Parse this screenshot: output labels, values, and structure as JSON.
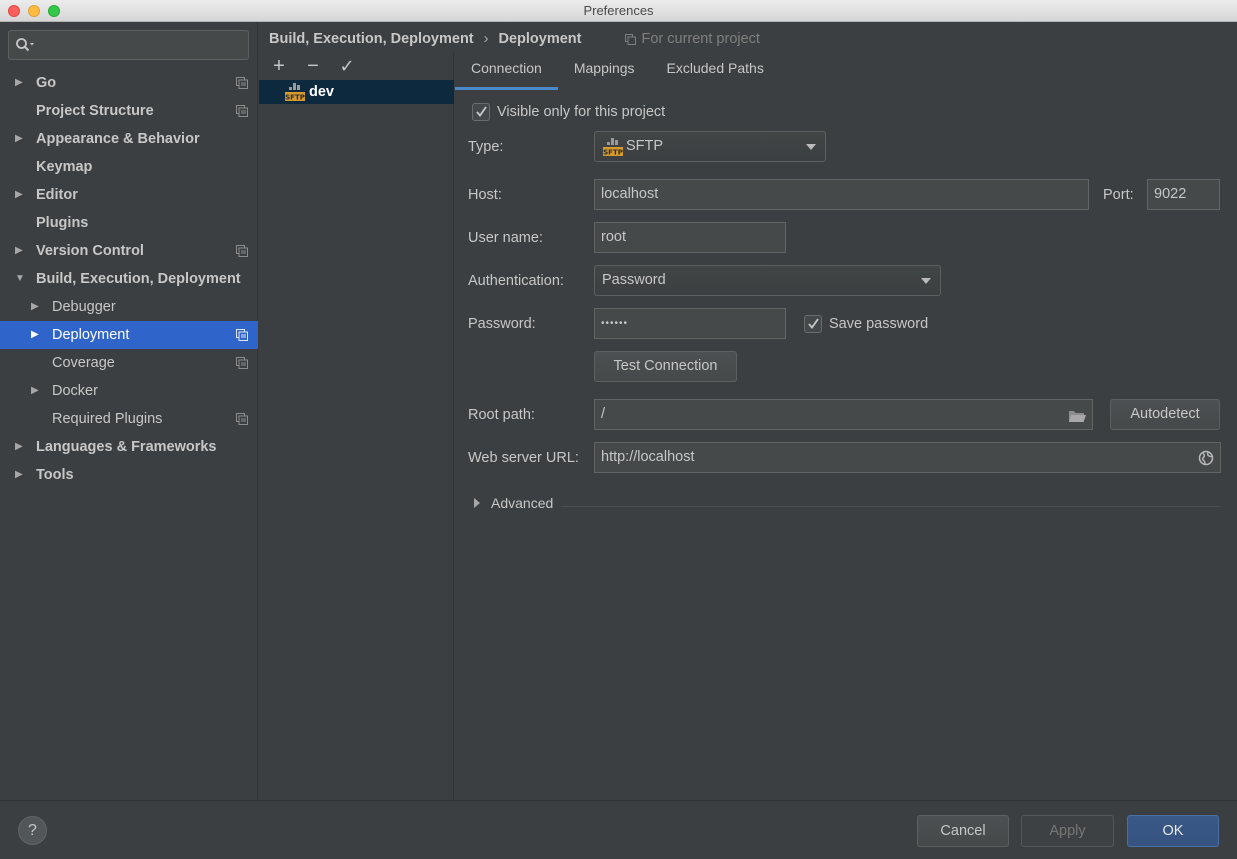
{
  "window": {
    "title": "Preferences"
  },
  "search": {
    "placeholder": ""
  },
  "sidebar": {
    "items": [
      {
        "label": "Go",
        "level": 0,
        "arrow": "right",
        "bold": true,
        "project_icon": true
      },
      {
        "label": "Project Structure",
        "level": 0,
        "arrow": "",
        "bold": true,
        "project_icon": true
      },
      {
        "label": "Appearance & Behavior",
        "level": 0,
        "arrow": "right",
        "bold": true,
        "project_icon": false
      },
      {
        "label": "Keymap",
        "level": 0,
        "arrow": "",
        "bold": true,
        "project_icon": false
      },
      {
        "label": "Editor",
        "level": 0,
        "arrow": "right",
        "bold": true,
        "project_icon": false
      },
      {
        "label": "Plugins",
        "level": 0,
        "arrow": "",
        "bold": true,
        "project_icon": false
      },
      {
        "label": "Version Control",
        "level": 0,
        "arrow": "right",
        "bold": true,
        "project_icon": true
      },
      {
        "label": "Build, Execution, Deployment",
        "level": 0,
        "arrow": "down",
        "bold": true,
        "project_icon": false
      },
      {
        "label": "Debugger",
        "level": 1,
        "arrow": "right",
        "bold": false,
        "project_icon": false
      },
      {
        "label": "Deployment",
        "level": 1,
        "arrow": "right",
        "bold": false,
        "project_icon": true,
        "selected": true
      },
      {
        "label": "Coverage",
        "level": 1,
        "arrow": "",
        "bold": false,
        "project_icon": true
      },
      {
        "label": "Docker",
        "level": 1,
        "arrow": "right",
        "bold": false,
        "project_icon": false
      },
      {
        "label": "Required Plugins",
        "level": 1,
        "arrow": "",
        "bold": false,
        "project_icon": true
      },
      {
        "label": "Languages & Frameworks",
        "level": 0,
        "arrow": "right",
        "bold": true,
        "project_icon": false
      },
      {
        "label": "Tools",
        "level": 0,
        "arrow": "right",
        "bold": true,
        "project_icon": false
      }
    ]
  },
  "breadcrumb": {
    "parent": "Build, Execution, Deployment",
    "separator": "›",
    "current": "Deployment",
    "scope": "For current project"
  },
  "toolbar": {
    "add": "+",
    "remove": "−",
    "apply": "✓"
  },
  "servers": [
    {
      "name": "dev",
      "icon": "sftp-icon"
    }
  ],
  "sftp_badge": "SFTP",
  "tabs": [
    {
      "label": "Connection",
      "active": true
    },
    {
      "label": "Mappings",
      "active": false
    },
    {
      "label": "Excluded Paths",
      "active": false
    }
  ],
  "connection": {
    "visible_only_label": "Visible only for this project",
    "visible_only_checked": true,
    "type_label": "Type:",
    "type_value": "SFTP",
    "host_label": "Host:",
    "host_value": "localhost",
    "port_label": "Port:",
    "port_value": "9022",
    "username_label": "User name:",
    "username_value": "root",
    "auth_label": "Authentication:",
    "auth_value": "Password",
    "password_label": "Password:",
    "password_value": "••••••",
    "save_password_label": "Save password",
    "save_password_checked": true,
    "test_connection_label": "Test Connection",
    "root_path_label": "Root path:",
    "root_path_value": "/",
    "autodetect_label": "Autodetect",
    "web_url_label": "Web server URL:",
    "web_url_value": "http://localhost",
    "advanced_label": "Advanced"
  },
  "footer": {
    "help": "?",
    "cancel": "Cancel",
    "apply": "Apply",
    "ok": "OK"
  },
  "colors": {
    "background": "#3c3f41",
    "selection": "#2f65ca",
    "list_selection": "#0d293e",
    "tab_underline": "#4a88c7",
    "ok_button": "#365380",
    "sftp_orange": "#d69a2d"
  }
}
